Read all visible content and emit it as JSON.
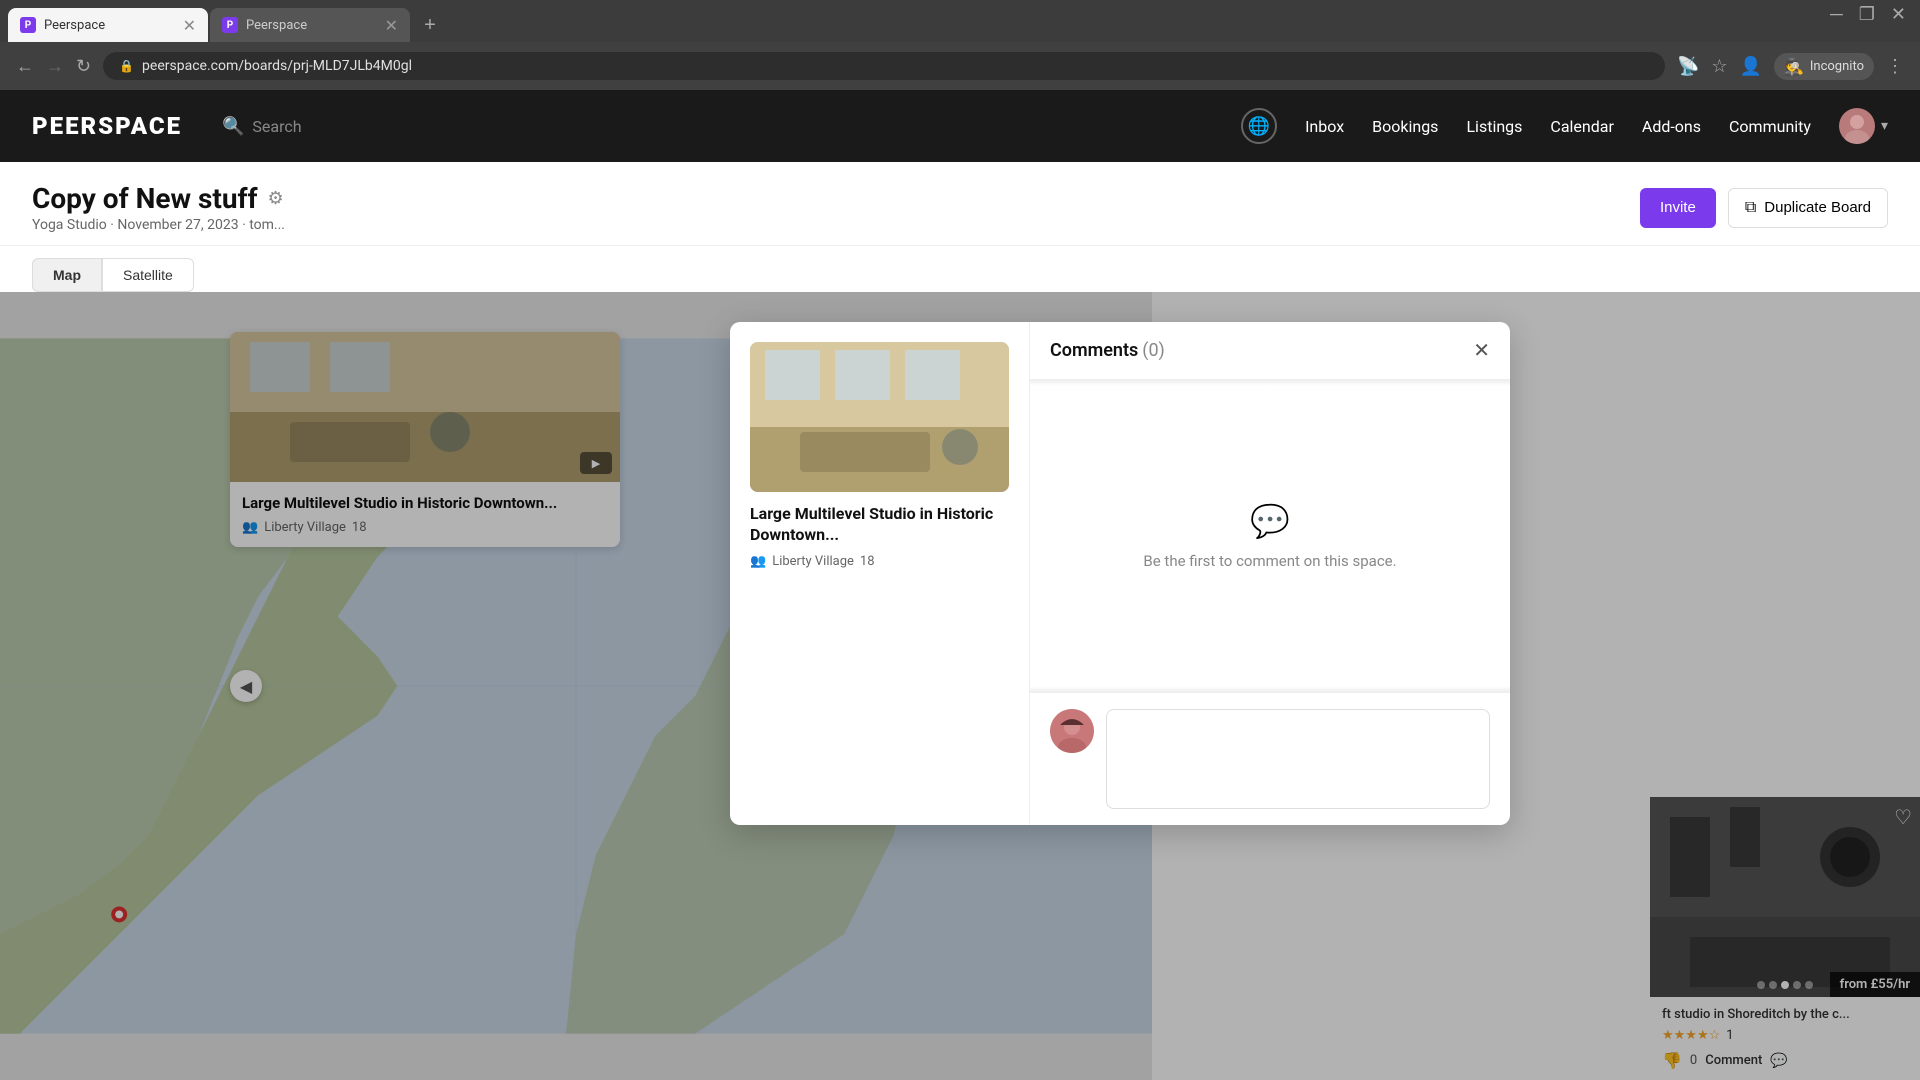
{
  "browser": {
    "tab1_label": "Peerspace",
    "tab2_label": "Peerspace",
    "url": "peerspace.com/boards/prj-MLD7JLb4M0gl",
    "incognito_label": "Incognito"
  },
  "header": {
    "logo": "PEERSPACE",
    "search_label": "Search",
    "nav": {
      "globe_title": "Globe",
      "inbox": "Inbox",
      "bookings": "Bookings",
      "listings": "Listings",
      "calendar": "Calendar",
      "addons": "Add-ons",
      "community": "Community"
    }
  },
  "page": {
    "title": "Copy of New stuff",
    "subtitle": "Yoga Studio · November 27, 2023 · tom...",
    "invite_btn": "Invite",
    "duplicate_btn": "Duplicate Board",
    "map_tab": "Map",
    "satellite_tab": "Satellite"
  },
  "listing_card": {
    "title": "Large Multilevel Studio in Historic Downtown...",
    "location": "Liberty Village",
    "people_count": "18"
  },
  "bottom_listing": {
    "title": "ft studio in Shoreditch by the c...",
    "stars": 4,
    "rating_count": "1",
    "price": "from £55/hr",
    "comment_count": "0",
    "comment_label": "Comment"
  },
  "modal": {
    "title": "Comments",
    "count": "(0)",
    "empty_message": "Be the first to comment on this space.",
    "placeholder": ""
  },
  "colors": {
    "purple": "#7c3aed",
    "dark_bg": "#1a1a1a"
  }
}
